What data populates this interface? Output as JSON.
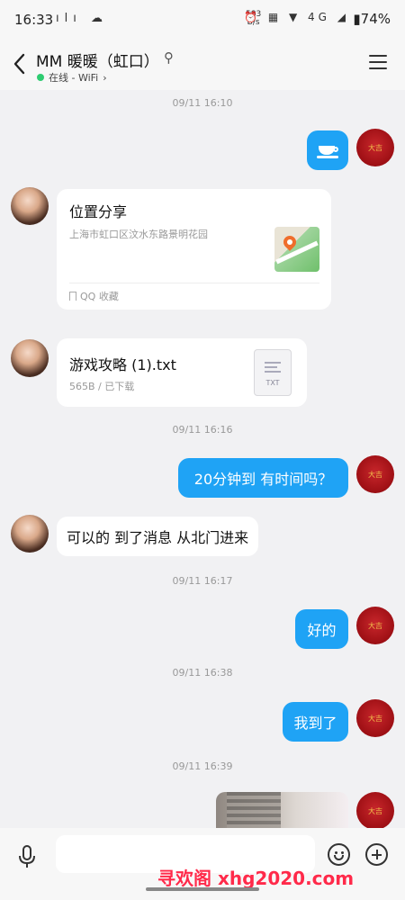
{
  "status_bar": {
    "time": "16:33",
    "speed_value": "583",
    "speed_unit": "B/s",
    "battery": "74%",
    "signal_label": "4G"
  },
  "header": {
    "title": "MM  暖暖（虹口）",
    "presence": "在线 - WiFi",
    "online_color": "#2ecc71"
  },
  "messages": {
    "ts1": "09/11 16:10",
    "location": {
      "title": "位置分享",
      "address": "上海市虹口区汶水东路景明花园",
      "source": "QQ 收藏"
    },
    "file": {
      "name": "游戏攻略 (1).txt",
      "meta": "565B / 已下载",
      "ext": "TXT"
    },
    "ts2": "09/11 16:16",
    "me1": "20分钟到 有时间吗？",
    "you1": "可以的 到了消息 从北门进来",
    "ts3": "09/11 16:17",
    "me2": "好的",
    "ts4": "09/11 16:38",
    "me3": "我到了",
    "ts5": "09/11 16:39"
  },
  "avatar_right": {
    "seal_text": "大吉"
  },
  "input": {
    "value": "",
    "placeholder": ""
  },
  "watermark": "寻欢阁 xhg2020.com",
  "colors": {
    "my_bubble": "#1fa3f5",
    "background": "#f1f1f3",
    "watermark": "#ff2a4a"
  }
}
